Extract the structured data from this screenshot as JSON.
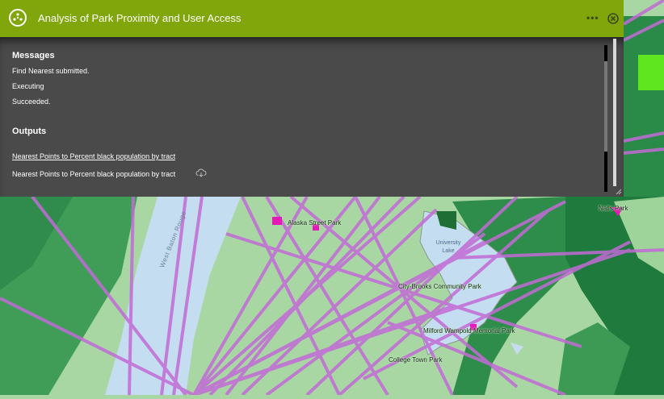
{
  "panel": {
    "title": "Analysis of Park Proximity and User Access",
    "icon": "analysis-icon",
    "more_icon": "more-options-icon",
    "close_icon": "close-icon",
    "messages_heading": "Messages",
    "messages": [
      "Find Nearest submitted.",
      "Executing",
      "Succeeded."
    ],
    "outputs_heading": "Outputs",
    "outputs": [
      {
        "label": "Nearest Points to Percent black population by tract",
        "link": true
      },
      {
        "label": "Nearest Points to Percent black population by tract",
        "link": false,
        "icon": "download-icon"
      }
    ],
    "colors": {
      "header": "#80a60b",
      "body": "#4a4a4a",
      "text": "#ffffff"
    }
  },
  "map": {
    "park_labels": [
      "Alaska Street Park",
      "City-Brooks Community Park",
      "Milford Wampold Memorial Park",
      "College Town Park",
      "Nalls Park"
    ],
    "lake_label": [
      "University",
      "Lake"
    ],
    "river_label": "West Baton Rouge",
    "colors": {
      "lines": "#c26ad6",
      "park_marker": "#e619b8",
      "water": "#c4ddf0",
      "light_green": "#a9d7a4",
      "mid_green": "#3d9a54",
      "dark_green": "#1e7a3e"
    }
  }
}
